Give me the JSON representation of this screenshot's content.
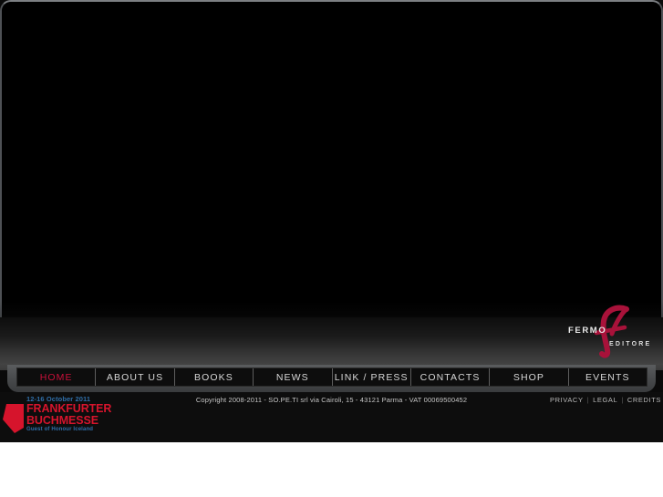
{
  "site": {
    "brand_name": "FERMO",
    "brand_suffix": "EDITORE",
    "brand_mark": "F"
  },
  "nav": {
    "items": [
      {
        "label": "HOME",
        "active": true
      },
      {
        "label": "ABOUT US",
        "active": false
      },
      {
        "label": "BOOKS",
        "active": false
      },
      {
        "label": "NEWS",
        "active": false
      },
      {
        "label": "LINK / PRESS",
        "active": false
      },
      {
        "label": "CONTACTS",
        "active": false
      },
      {
        "label": "SHOP",
        "active": false
      },
      {
        "label": "EVENTS",
        "active": false
      }
    ]
  },
  "footer": {
    "copyright": "Copyright 2008-2011 - SO.PE.TI srl via Cairoli, 15 - 43121 Parma - VAT 00069500452",
    "links": [
      {
        "label": "PRIVACY"
      },
      {
        "label": "LEGAL"
      },
      {
        "label": "CREDITS"
      }
    ],
    "fair_badge": {
      "dates": "12-16 October 2011",
      "line1": "FRANKFURTER",
      "line2": "BUCHMESSE",
      "tagline": "Guest of Honour Iceland"
    }
  },
  "colors": {
    "accent_red": "#c9103a",
    "brand_red": "#a8123a",
    "fair_red": "#d6142c",
    "fair_blue": "#2f6ea8",
    "stage_black": "#000000",
    "footer_black": "#0d0d0d",
    "nav_shelf_gray": "#4a4c4e"
  }
}
